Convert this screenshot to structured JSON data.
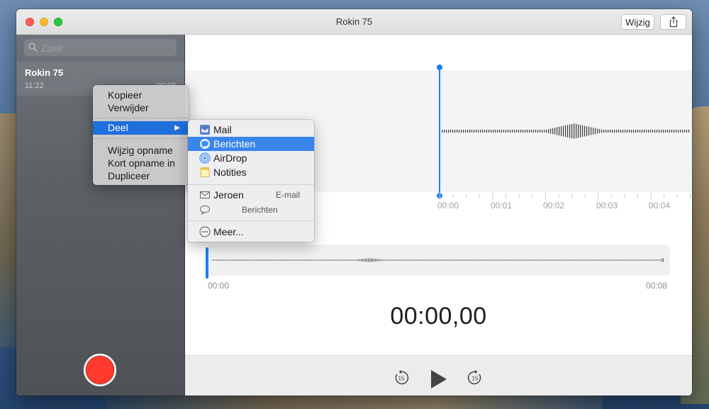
{
  "window": {
    "title": "Rokin 75",
    "edit_label": "Wijzig",
    "share_icon": "share-icon"
  },
  "sidebar": {
    "search_placeholder": "Zoek",
    "recordings": [
      {
        "name": "Rokin 75",
        "time": "11:22",
        "duration": "00:08"
      }
    ]
  },
  "editor": {
    "ticks": [
      "00:00",
      "00:01",
      "00:02",
      "00:03",
      "00:04"
    ],
    "overview_start": "00:00",
    "overview_end": "00:08",
    "current_time": "00:00,00",
    "playhead_color": "#1f7ef0",
    "record_color": "#ff3b30"
  },
  "controls": {
    "skip_back_label": "15",
    "skip_forward_label": "15"
  },
  "context_menu": {
    "items": [
      "Kopieer",
      "Verwijder",
      "Deel",
      "Wijzig opname",
      "Kort opname in",
      "Dupliceer"
    ],
    "active": "Deel",
    "highlight_color": "#1f6fdc"
  },
  "share_menu": {
    "services": [
      "Mail",
      "Berichten",
      "AirDrop",
      "Notities"
    ],
    "active": "Berichten",
    "contacts": [
      {
        "name": "Jeroen",
        "type": "E-mail"
      },
      {
        "name": "",
        "type": "Berichten"
      }
    ],
    "more": "Meer..."
  }
}
